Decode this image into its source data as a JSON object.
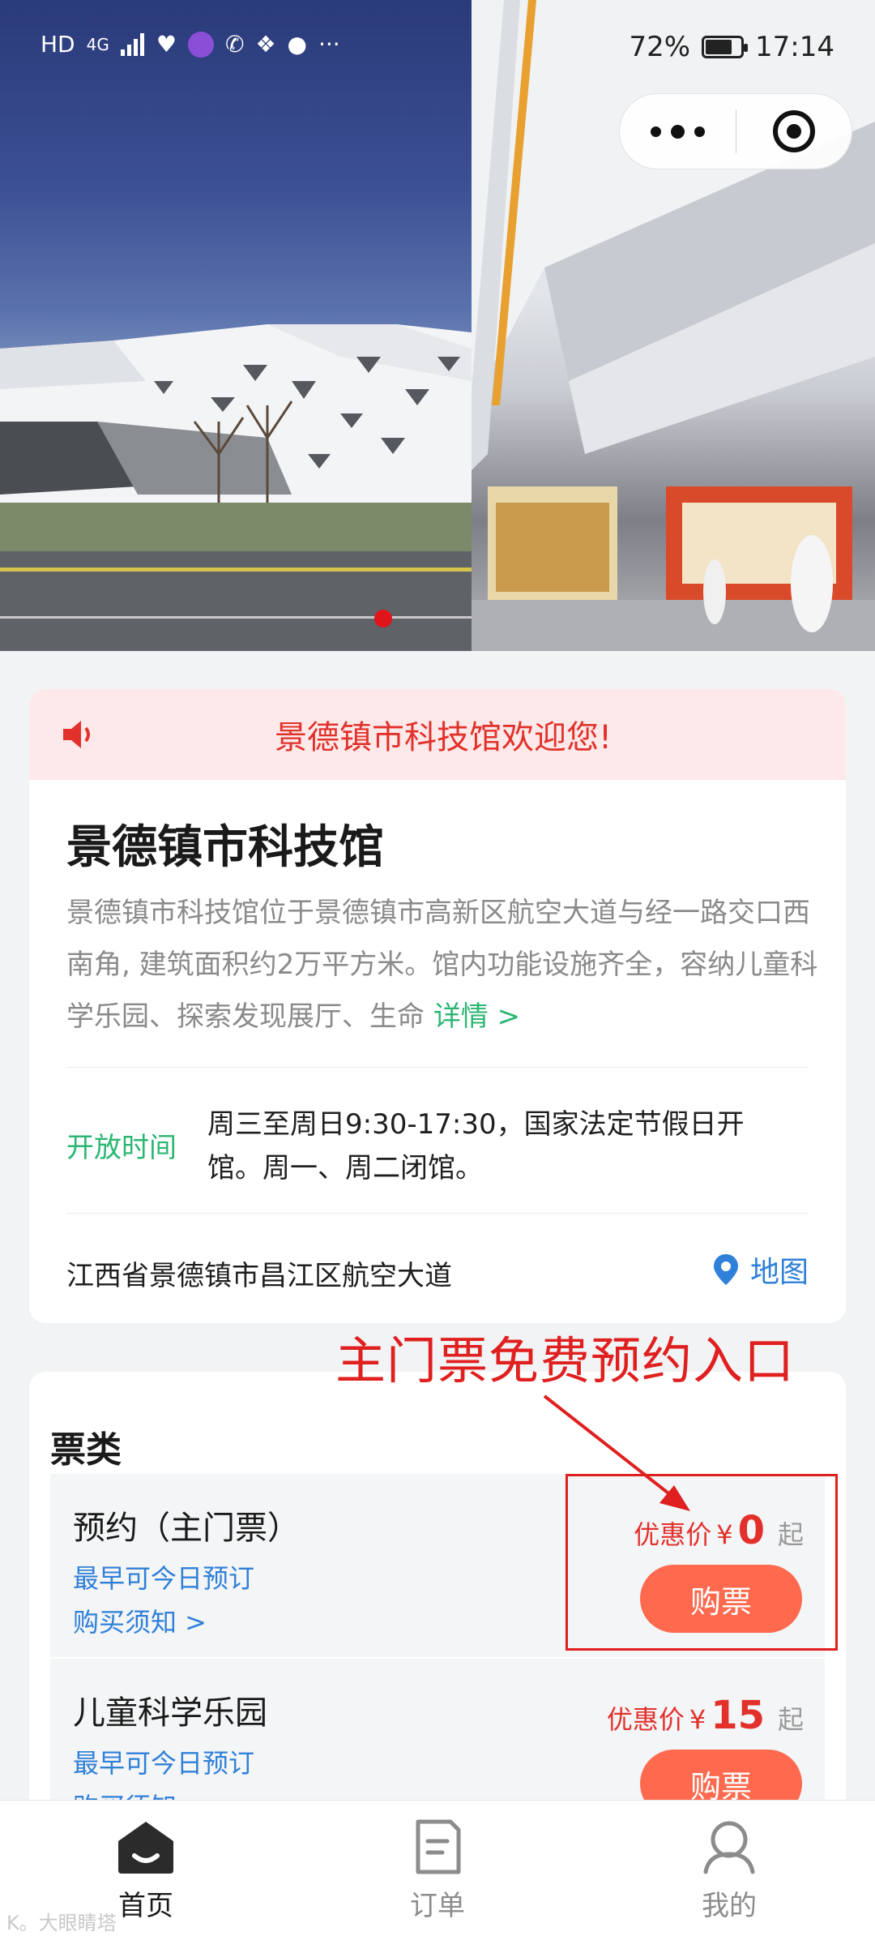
{
  "status_bar": {
    "left_icons": [
      "HD",
      "4G",
      "signal-icon",
      "health-icon",
      "app-icon",
      "call-icon",
      "wechat-icon",
      "chat-icon",
      "···"
    ],
    "battery_percent": "72%",
    "battery_level": 0.72,
    "time": "17:14"
  },
  "banner": {
    "slide_count": 1,
    "active_index": 0,
    "accent_color": "#e0151a"
  },
  "notice": {
    "text": "景德镇市科技馆欢迎您!"
  },
  "venue": {
    "title": "景德镇市科技馆",
    "description": "景德镇市科技馆位于景德镇市高新区航空大道与经一路交口西南角, 建筑面积约2万平方米。馆内功能设施齐全，容纳儿童科学乐园、探索发现展厅、生命",
    "more_link": "详情 >",
    "hours_label": "开放时间",
    "hours_text": "周三至周日9:30-17:30，国家法定节假日开馆。周一、周二闭馆。",
    "address": "江西省景德镇市昌江区航空大道",
    "map_label": "地图"
  },
  "annotation": {
    "text": "主门票免费预约入口",
    "color": "#e01f1f"
  },
  "tickets": {
    "title": "票类",
    "items": [
      {
        "name": "预约（主门票）",
        "earliest": "最早可今日预订",
        "notice": "购买须知 >",
        "price_label": "优惠价",
        "currency": "¥",
        "price": "0",
        "suffix": "起",
        "buy_label": "购票"
      },
      {
        "name": "儿童科学乐园",
        "earliest": "最早可今日预订",
        "notice": "购买须知 >",
        "price_label": "优惠价",
        "currency": "¥",
        "price": "15",
        "suffix": "起",
        "buy_label": "购票"
      }
    ]
  },
  "tab_bar": {
    "tabs": [
      {
        "label": "首页",
        "icon": "home-icon",
        "active": true
      },
      {
        "label": "订单",
        "icon": "order-icon",
        "active": false
      },
      {
        "label": "我的",
        "icon": "profile-icon",
        "active": false
      }
    ]
  },
  "watermark": "K。大眼睛塔",
  "colors": {
    "primary_red": "#e2312b",
    "green": "#2bb673",
    "blue": "#2f80d8",
    "buy_button": "#ff6a4f"
  }
}
